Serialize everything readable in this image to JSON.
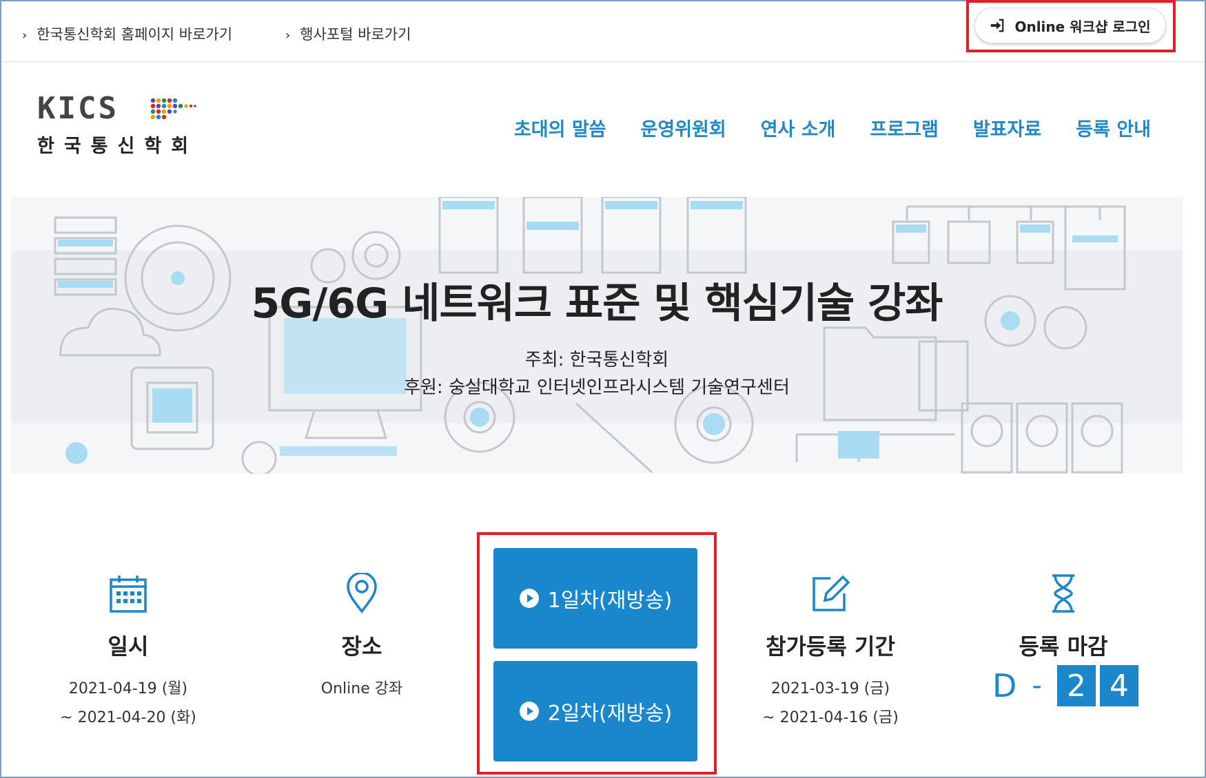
{
  "topbar": {
    "links": [
      {
        "label": "한국통신학회 홈페이지 바로가기"
      },
      {
        "label": "행사포털 바로가기"
      }
    ],
    "login_label": "Online 워크샵 로그인"
  },
  "logo": {
    "main": "KICS",
    "sub": "한국통신학회"
  },
  "nav": [
    {
      "label": "초대의 말씀"
    },
    {
      "label": "운영위원회"
    },
    {
      "label": "연사 소개"
    },
    {
      "label": "프로그램"
    },
    {
      "label": "발표자료"
    },
    {
      "label": "등록 안내"
    }
  ],
  "banner": {
    "title": "5G/6G 네트워크 표준 및 핵심기술 강좌",
    "host": "주최: 한국통신학회",
    "sponsor": "후원: 숭실대학교 인터넷인프라시스템 기술연구센터"
  },
  "info": {
    "date": {
      "label": "일시",
      "line1": "2021-04-19 (월)",
      "line2": "~ 2021-04-20 (화)",
      "icon": "calendar-icon"
    },
    "place": {
      "label": "장소",
      "line1": "Online 강좌",
      "icon": "map-pin-icon"
    },
    "registration": {
      "label": "참가등록 기간",
      "line1": "2021-03-19 (금)",
      "line2": "~ 2021-04-16 (금)",
      "icon": "edit-icon"
    },
    "deadline": {
      "label": "등록 마감",
      "d_letter": "D",
      "separator": "-",
      "digits": [
        "2",
        "4"
      ],
      "icon": "hourglass-icon"
    }
  },
  "replay": [
    {
      "label": "1일차(재방송)"
    },
    {
      "label": "2일차(재방송)"
    }
  ],
  "colors": {
    "accent": "#1a86cc",
    "nav": "#1e88c8",
    "highlight": "#e01f26"
  }
}
